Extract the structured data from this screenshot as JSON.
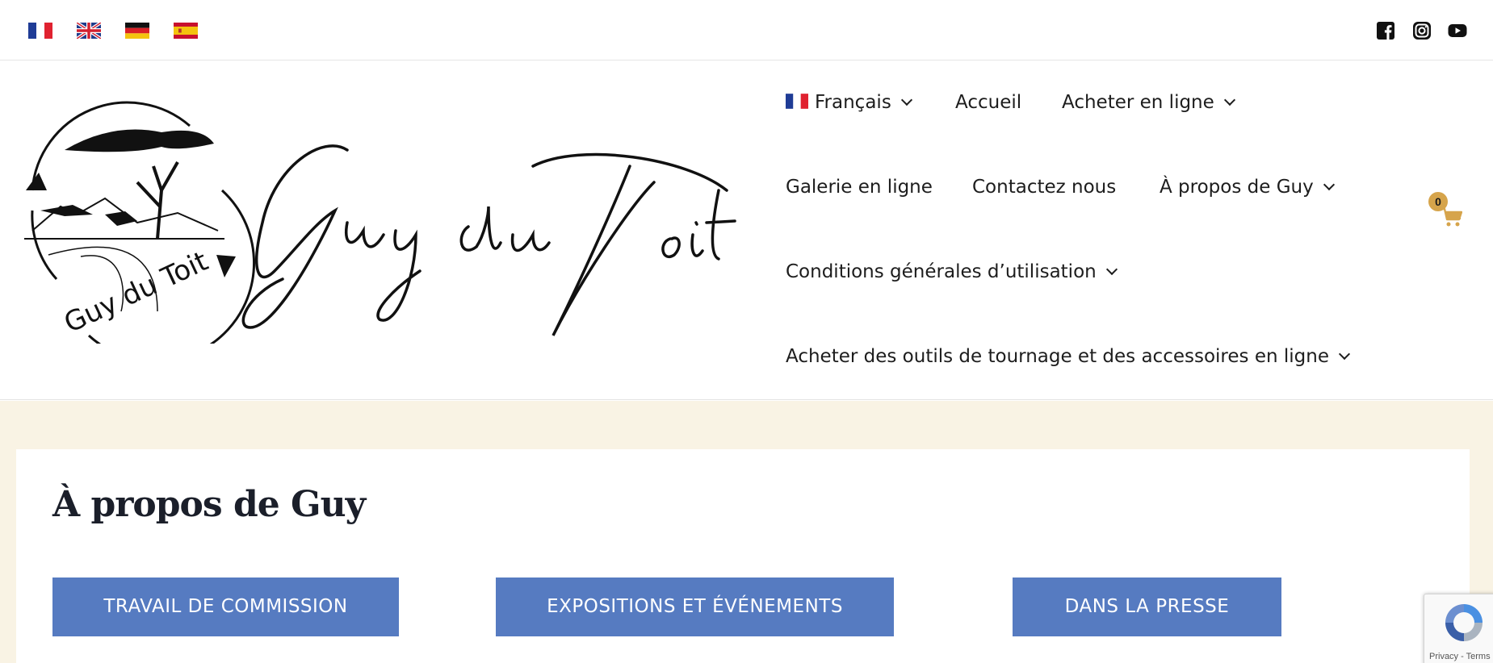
{
  "top_bar": {
    "flags": [
      {
        "name": "flag-fr-icon",
        "lang": "fr"
      },
      {
        "name": "flag-uk-icon",
        "lang": "en"
      },
      {
        "name": "flag-de-icon",
        "lang": "de"
      },
      {
        "name": "flag-es-icon",
        "lang": "es"
      }
    ],
    "social": [
      {
        "name": "facebook-icon"
      },
      {
        "name": "instagram-icon"
      },
      {
        "name": "youtube-icon"
      }
    ]
  },
  "logo": {
    "circle_text": "Guy du Toit",
    "script_text": "Guy du Toit"
  },
  "nav": {
    "language_label": "Français",
    "home": "Accueil",
    "buy_online": "Acheter en ligne",
    "gallery": "Galerie en ligne",
    "contact": "Contactez nous",
    "about": "À propos de Guy",
    "terms": "Conditions générales d’utilisation",
    "tools": "Acheter des outils de tournage et des accessoires en ligne"
  },
  "cart": {
    "count": "0"
  },
  "colors": {
    "accent_gold": "#d6a44b",
    "button_blue": "#567bc1",
    "page_bg_cream": "#f9f3e4"
  },
  "main": {
    "title": "À propos de Guy",
    "buttons": [
      {
        "label": "TRAVAIL DE COMMISSION"
      },
      {
        "label": "EXPOSITIONS ET ÉVÉNEMENTS"
      },
      {
        "label": "DANS LA PRESSE"
      }
    ]
  },
  "recaptcha": {
    "footer_text": "Privacy - Terms"
  }
}
